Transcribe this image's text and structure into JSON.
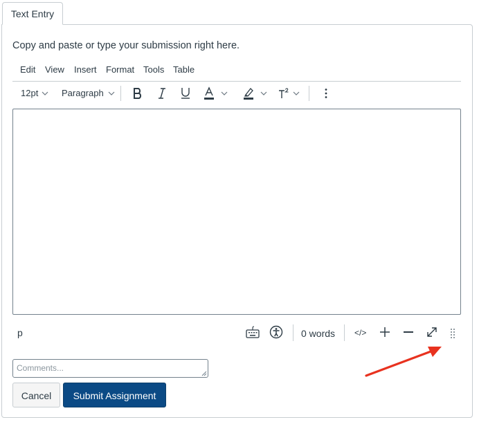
{
  "tabs": [
    {
      "label": "Text Entry"
    }
  ],
  "instructions": "Copy and paste or type your submission right here.",
  "menubar": {
    "items": [
      "Edit",
      "View",
      "Insert",
      "Format",
      "Tools",
      "Table"
    ]
  },
  "toolbar": {
    "font_size": "12pt",
    "block_format": "Paragraph",
    "bold_icon": "bold-icon",
    "italic_icon": "italic-icon",
    "underline_icon": "underline-icon",
    "text_color_icon": "text-color-icon",
    "highlight_icon": "highlight-color-icon",
    "superscript_icon": "superscript-icon",
    "more_icon": "more-vertical-icon"
  },
  "editor": {
    "content": ""
  },
  "statusbar": {
    "element_path": "p",
    "word_count": "0 words",
    "html_toggle": "</>"
  },
  "comments": {
    "placeholder": "Comments..."
  },
  "buttons": {
    "cancel": "Cancel",
    "submit": "Submit Assignment"
  },
  "colors": {
    "primary": "#0b4a85",
    "border": "#c7cdd1",
    "arrow": "#e8321f",
    "text": "#2d3b45"
  }
}
